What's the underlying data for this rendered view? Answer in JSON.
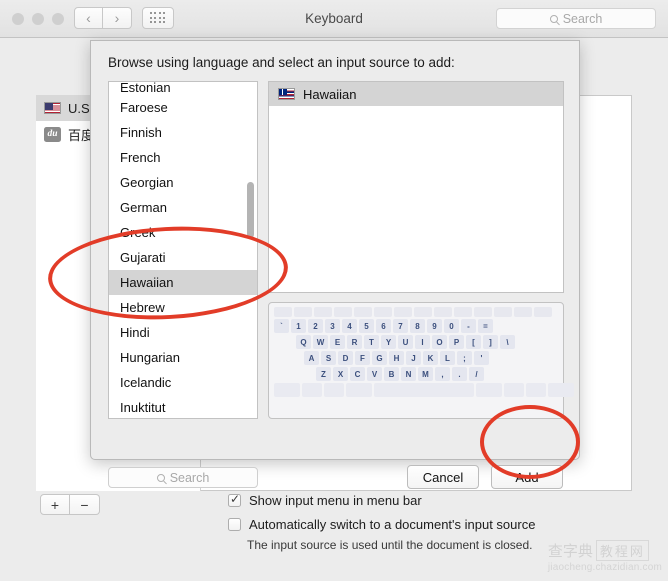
{
  "window": {
    "title": "Keyboard",
    "search_placeholder": "Search",
    "nav_back_icon": "chevron-left-icon",
    "nav_forward_icon": "chevron-right-icon",
    "grid_icon": "show-all-grid-icon"
  },
  "prefpane": {
    "input_sources": [
      {
        "label": "U.S.",
        "icon": "us-flag-icon",
        "selected": true
      },
      {
        "label": "百度",
        "icon": "du-badge-icon",
        "selected": false
      }
    ],
    "add_button": "+",
    "remove_button": "−",
    "options": [
      {
        "label": "Show input menu in menu bar",
        "checked": true
      },
      {
        "label": "Automatically switch to a document's input source",
        "checked": false
      }
    ],
    "hint": "The input source is used until the document is closed."
  },
  "sheet": {
    "title": "Browse using language and select an input source to add:",
    "languages": [
      "Estonian",
      "Faroese",
      "Finnish",
      "French",
      "Georgian",
      "German",
      "Greek",
      "Gujarati",
      "Hawaiian",
      "Hebrew",
      "Hindi",
      "Hungarian",
      "Icelandic",
      "Inuktitut"
    ],
    "selected_language": "Hawaiian",
    "source_items": [
      {
        "label": "Hawaiian",
        "icon": "hawaii-flag-icon",
        "selected": true
      }
    ],
    "search_placeholder": "Search",
    "cancel_label": "Cancel",
    "add_label": "Add",
    "keyboard_rows": [
      [
        "`",
        "1",
        "2",
        "3",
        "4",
        "5",
        "6",
        "7",
        "8",
        "9",
        "0",
        "-",
        "="
      ],
      [
        "Q",
        "W",
        "E",
        "R",
        "T",
        "Y",
        "U",
        "I",
        "O",
        "P",
        "[",
        "]",
        "\\"
      ],
      [
        "A",
        "S",
        "D",
        "F",
        "G",
        "H",
        "J",
        "K",
        "L",
        ";",
        "'"
      ],
      [
        "Z",
        "X",
        "C",
        "V",
        "B",
        "N",
        "M",
        ",",
        ".",
        "/"
      ]
    ]
  },
  "annotations": {
    "accent_color": "#e23c28",
    "highlight_language": "Hawaiian",
    "highlight_button": "Add"
  },
  "watermark": {
    "brand": "查字典",
    "suffix": "教程网",
    "url": "jiaocheng.chazidian.com"
  }
}
